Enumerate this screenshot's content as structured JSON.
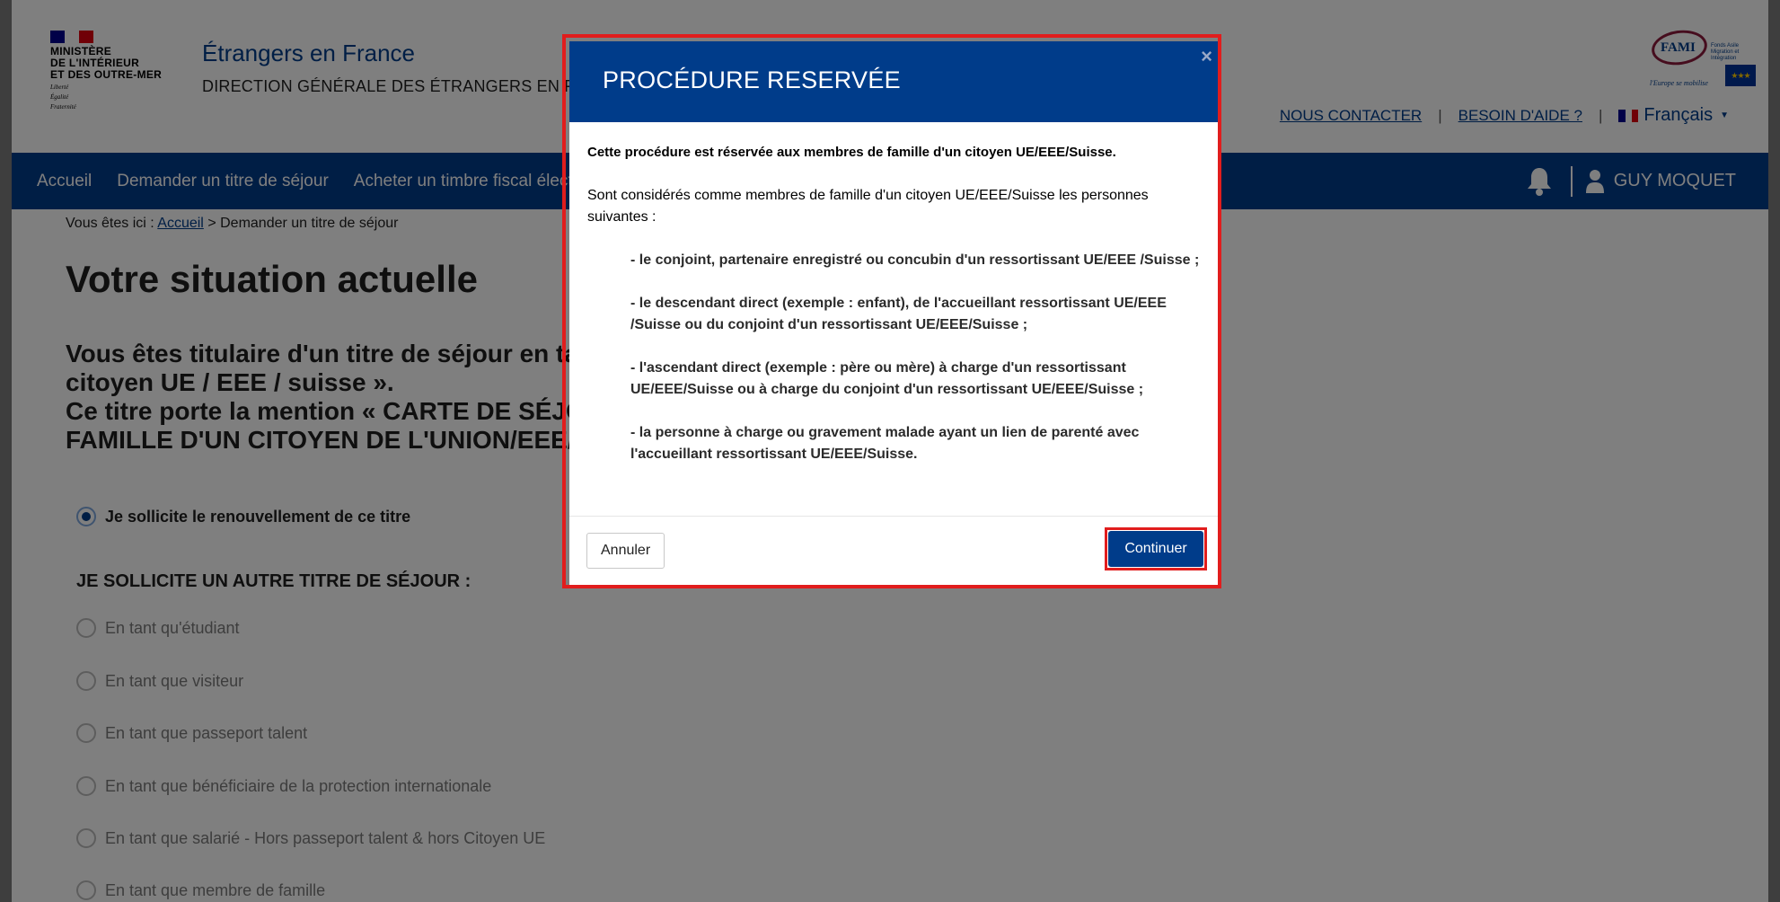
{
  "header": {
    "gov_lines": [
      "MINISTÈRE",
      "DE L'INTÉRIEUR",
      "ET DES OUTRE-MER"
    ],
    "devise": [
      "Liberté",
      "Égalité",
      "Fraternité"
    ],
    "site_title": "Étrangers en France",
    "site_subtitle": "DIRECTION GÉNÉRALE DES ÉTRANGERS EN FRANCE",
    "fami_word": "FAMI",
    "fami_small": "Fonds Asile Migration et Intégration",
    "fami_motto": "l'Europe se mobilise",
    "links": {
      "contact": "NOUS CONTACTER",
      "help": "BESOIN D'AIDE ?",
      "separator": "|"
    },
    "language": "Français"
  },
  "nav": {
    "items": [
      "Accueil",
      "Demander un titre de séjour",
      "Acheter un timbre fiscal électronique"
    ],
    "user": "GUY MOQUET"
  },
  "breadcrumb": {
    "prefix": "Vous êtes ici :",
    "home": "Accueil",
    "separator": ">",
    "current": "Demander un titre de séjour"
  },
  "main": {
    "title": "Votre situation actuelle",
    "info_lines": [
      "Vous êtes titulaire d'un titre de séjour en tant que « membre de famille d'un",
      "citoyen UE / EEE / suisse ».",
      "Ce titre porte la mention « CARTE DE SÉJOUR - MEMBRE DE LA",
      "FAMILLE D'UN CITOYEN DE L'UNION/EEE/SUISSE »."
    ],
    "renewal_option": "Je sollicite le renouvellement de ce titre",
    "other_title_label": "JE SOLLICITE UN AUTRE TITRE DE SÉJOUR :",
    "other_options": [
      "En tant qu'étudiant",
      "En tant que visiteur",
      "En tant que passeport talent",
      "En tant que bénéficiaire de la protection internationale",
      "En tant que salarié - Hors passeport talent & hors Citoyen UE",
      "En tant que membre de famille"
    ]
  },
  "modal": {
    "title": "PROCÉDURE RESERVÉE",
    "close": "×",
    "intro": "Cette procédure est réservée aux membres de famille d'un citoyen UE/EEE/Suisse.",
    "para": "Sont considérés comme membres de famille d'un citoyen UE/EEE/Suisse les personnes suivantes :",
    "items": [
      "- le conjoint, partenaire enregistré ou concubin d'un ressortissant UE/EEE /Suisse ;",
      "- le descendant direct (exemple : enfant), de l'accueillant ressortissant UE/EEE /Suisse ou du conjoint d'un ressortissant UE/EEE/Suisse ;",
      "- l'ascendant direct (exemple : père ou mère) à charge d'un ressortissant UE/EEE/Suisse ou à charge du conjoint d'un ressortissant UE/EEE/Suisse ;",
      "- la personne à charge ou gravement malade ayant un lien de parenté avec l'accueillant ressortissant UE/EEE/Suisse."
    ],
    "cancel": "Annuler",
    "continue": "Continuer"
  },
  "colors": {
    "primary": "#003c8a",
    "highlight": "#e11d1d",
    "flag_blue": "#000091",
    "flag_red": "#e1000f"
  }
}
